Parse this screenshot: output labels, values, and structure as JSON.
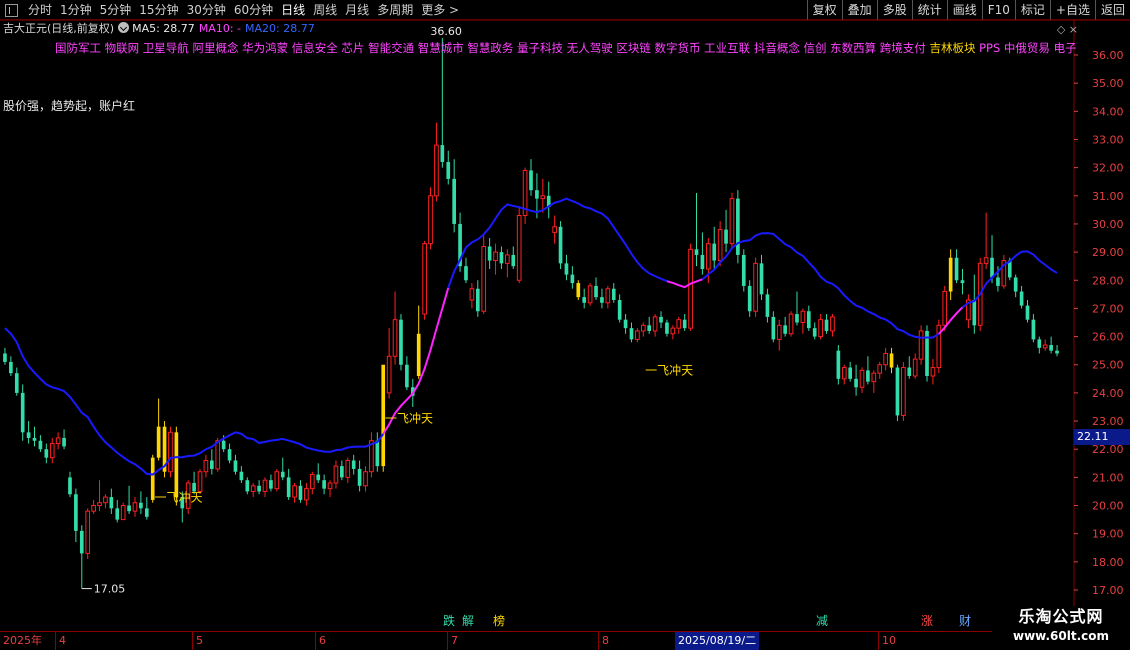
{
  "toolbar": {
    "tabs": [
      "分时",
      "1分钟",
      "5分钟",
      "15分钟",
      "30分钟",
      "60分钟",
      "日线",
      "周线",
      "月线",
      "多周期",
      "更多"
    ],
    "active_tab": "日线",
    "more_suffix": ">",
    "right_buttons": [
      "复权",
      "叠加",
      "多股",
      "统计",
      "画线",
      "F10",
      "+自选",
      "返回"
    ],
    "mark_label": "标记"
  },
  "info": {
    "stock_title": "吉大正元(日线,前复权)",
    "ma5": "MA5: 28.77",
    "ma10": "MA10: -",
    "ma20": "MA20: 28.77",
    "corner_icons": "◇ ×"
  },
  "concepts": "国防军工 物联网 卫星导航 阿里概念 华为鸿蒙 信息安全 芯片 智能交通 智慧城市 智慧政务 量子科技 无人驾驶 区块链 数字货币 工业互联 抖音概念 信创 东数西算 跨境支付 吉林板块 PPS 中俄贸易 电子身份",
  "concept_highlight": "吉林板块",
  "slogan": "股价强，趋势起，账户红",
  "colors": {
    "up": "#ff2020",
    "down": "#33ddaa",
    "signal": "#ffd700",
    "ma_blue": "#1a1aff",
    "ma_pink": "#ff22ff",
    "axis": "#e84040"
  },
  "chart_data": {
    "type": "candlestick",
    "y_axis": {
      "ticks": [
        "36.00",
        "35.00",
        "34.00",
        "33.00",
        "32.00",
        "31.00",
        "30.00",
        "29.00",
        "28.00",
        "27.00",
        "26.00",
        "25.00",
        "24.00",
        "23.00",
        "22.00",
        "21.00",
        "20.00",
        "19.00",
        "18.00",
        "17.00"
      ],
      "range": [
        17.0,
        36.5
      ],
      "current_marker": "22.11"
    },
    "annotations": {
      "high": "36.60",
      "low": "17.05",
      "signal_text": "一飞冲天"
    },
    "candles": [
      [
        25.4,
        25.6,
        25.0,
        25.1
      ],
      [
        25.1,
        25.3,
        24.6,
        24.7
      ],
      [
        24.7,
        24.9,
        23.9,
        24.0
      ],
      [
        24.0,
        24.3,
        22.3,
        22.6
      ],
      [
        22.6,
        23.0,
        22.2,
        22.4
      ],
      [
        22.4,
        22.8,
        22.1,
        22.3
      ],
      [
        22.3,
        22.5,
        21.9,
        22.0
      ],
      [
        22.0,
        22.2,
        21.5,
        21.7
      ],
      [
        21.7,
        22.4,
        21.5,
        22.2
      ],
      [
        22.2,
        22.6,
        22.0,
        22.4
      ],
      [
        22.4,
        22.7,
        22.0,
        22.1
      ],
      [
        21.0,
        21.2,
        20.3,
        20.4
      ],
      [
        20.4,
        20.6,
        18.7,
        19.1
      ],
      [
        19.1,
        19.3,
        17.05,
        18.3
      ],
      [
        18.3,
        19.9,
        18.1,
        19.8
      ],
      [
        19.8,
        20.2,
        19.7,
        20.0
      ],
      [
        20.0,
        20.9,
        19.8,
        20.1
      ],
      [
        20.1,
        20.4,
        19.9,
        20.3
      ],
      [
        20.3,
        20.6,
        19.7,
        19.9
      ],
      [
        19.9,
        20.2,
        19.4,
        19.5
      ],
      [
        19.5,
        20.1,
        19.5,
        20.0
      ],
      [
        20.0,
        20.7,
        19.7,
        19.8
      ],
      [
        19.8,
        20.3,
        19.6,
        20.1
      ],
      [
        20.1,
        20.5,
        19.7,
        19.9
      ],
      [
        19.9,
        20.3,
        19.5,
        19.6
      ],
      [
        20.2,
        21.8,
        20.1,
        21.7
      ],
      [
        21.7,
        23.8,
        21.6,
        22.8
      ],
      [
        22.8,
        23.0,
        21.0,
        21.2
      ],
      [
        21.2,
        22.8,
        21.0,
        22.6
      ],
      [
        22.6,
        22.8,
        20.0,
        20.3
      ],
      [
        20.3,
        20.5,
        19.4,
        19.9
      ],
      [
        19.9,
        20.9,
        19.7,
        20.8
      ],
      [
        20.8,
        21.2,
        20.4,
        20.5
      ],
      [
        20.5,
        21.3,
        20.4,
        21.2
      ],
      [
        21.2,
        21.8,
        21.0,
        21.6
      ],
      [
        21.6,
        22.0,
        21.1,
        21.3
      ],
      [
        21.3,
        22.4,
        21.2,
        22.3
      ],
      [
        22.3,
        22.5,
        21.9,
        22.0
      ],
      [
        22.0,
        22.2,
        21.5,
        21.6
      ],
      [
        21.6,
        21.8,
        21.1,
        21.2
      ],
      [
        21.2,
        21.4,
        20.8,
        20.9
      ],
      [
        20.9,
        21.0,
        20.4,
        20.5
      ],
      [
        20.5,
        20.8,
        20.3,
        20.7
      ],
      [
        20.7,
        20.9,
        20.4,
        20.5
      ],
      [
        20.5,
        21.0,
        20.3,
        20.9
      ],
      [
        20.9,
        21.1,
        20.5,
        20.6
      ],
      [
        20.6,
        21.3,
        20.5,
        21.2
      ],
      [
        21.2,
        21.7,
        20.9,
        21.0
      ],
      [
        21.0,
        21.3,
        20.2,
        20.3
      ],
      [
        20.3,
        20.8,
        20.1,
        20.7
      ],
      [
        20.7,
        20.9,
        20.1,
        20.2
      ],
      [
        20.2,
        20.8,
        20.0,
        20.6
      ],
      [
        20.6,
        21.2,
        20.4,
        21.1
      ],
      [
        21.1,
        21.5,
        20.8,
        20.9
      ],
      [
        20.9,
        21.1,
        20.4,
        20.6
      ],
      [
        20.6,
        20.9,
        20.3,
        20.8
      ],
      [
        20.8,
        21.6,
        20.6,
        21.4
      ],
      [
        21.4,
        21.6,
        20.9,
        21.0
      ],
      [
        21.0,
        21.7,
        20.8,
        21.6
      ],
      [
        21.6,
        21.8,
        21.1,
        21.3
      ],
      [
        21.3,
        21.6,
        20.5,
        20.7
      ],
      [
        20.7,
        21.4,
        20.5,
        21.2
      ],
      [
        21.2,
        22.6,
        21.0,
        22.3
      ],
      [
        22.3,
        22.6,
        21.2,
        21.4
      ],
      [
        21.4,
        24.3,
        21.2,
        25.0
      ],
      [
        24.0,
        26.3,
        23.8,
        25.3
      ],
      [
        25.3,
        27.6,
        25.0,
        26.6
      ],
      [
        26.6,
        26.8,
        24.8,
        25.0
      ],
      [
        25.0,
        25.3,
        24.1,
        24.2
      ],
      [
        24.2,
        24.5,
        23.5,
        23.9
      ],
      [
        24.6,
        27.1,
        24.5,
        26.1
      ],
      [
        26.8,
        29.4,
        26.6,
        29.3
      ],
      [
        29.3,
        31.3,
        29.1,
        31.0
      ],
      [
        31.0,
        33.6,
        30.8,
        32.8
      ],
      [
        32.8,
        36.6,
        32.0,
        32.2
      ],
      [
        32.2,
        32.6,
        31.4,
        31.6
      ],
      [
        31.6,
        32.3,
        29.7,
        30.0
      ],
      [
        30.0,
        30.4,
        28.3,
        28.5
      ],
      [
        28.5,
        28.8,
        27.9,
        28.0
      ],
      [
        27.3,
        27.9,
        27.0,
        27.7
      ],
      [
        27.7,
        28.0,
        26.7,
        26.9
      ],
      [
        26.9,
        29.6,
        26.8,
        29.2
      ],
      [
        29.2,
        29.5,
        28.4,
        28.7
      ],
      [
        28.7,
        29.3,
        28.2,
        29.0
      ],
      [
        29.0,
        29.2,
        28.4,
        28.6
      ],
      [
        28.6,
        29.1,
        28.1,
        28.9
      ],
      [
        28.9,
        29.2,
        28.4,
        28.5
      ],
      [
        28.0,
        30.6,
        27.9,
        30.3
      ],
      [
        30.3,
        32.0,
        30.0,
        31.9
      ],
      [
        31.9,
        32.3,
        31.0,
        31.2
      ],
      [
        31.2,
        31.8,
        30.2,
        30.9
      ],
      [
        30.9,
        31.6,
        30.4,
        31.0
      ],
      [
        31.0,
        31.5,
        30.2,
        30.6
      ],
      [
        29.7,
        30.3,
        29.3,
        29.9
      ],
      [
        29.9,
        30.1,
        28.4,
        28.6
      ],
      [
        28.6,
        28.9,
        28.0,
        28.2
      ],
      [
        28.2,
        28.5,
        27.7,
        27.9
      ],
      [
        27.9,
        28.0,
        27.3,
        27.4
      ],
      [
        27.4,
        27.7,
        27.0,
        27.2
      ],
      [
        27.2,
        27.9,
        27.1,
        27.8
      ],
      [
        27.8,
        28.1,
        27.3,
        27.4
      ],
      [
        27.4,
        27.7,
        27.0,
        27.2
      ],
      [
        27.2,
        27.8,
        27.0,
        27.7
      ],
      [
        27.7,
        27.9,
        27.2,
        27.3
      ],
      [
        27.3,
        27.5,
        26.5,
        26.6
      ],
      [
        26.6,
        26.8,
        26.1,
        26.3
      ],
      [
        26.3,
        26.5,
        25.8,
        25.9
      ],
      [
        25.9,
        26.3,
        25.8,
        26.2
      ],
      [
        26.2,
        26.5,
        26.0,
        26.4
      ],
      [
        26.4,
        26.7,
        26.1,
        26.2
      ],
      [
        26.2,
        26.8,
        26.0,
        26.7
      ],
      [
        26.7,
        26.9,
        26.3,
        26.5
      ],
      [
        26.5,
        26.6,
        26.0,
        26.1
      ],
      [
        26.1,
        26.4,
        25.9,
        26.3
      ],
      [
        26.3,
        26.7,
        26.1,
        26.6
      ],
      [
        26.6,
        26.8,
        26.2,
        26.3
      ],
      [
        26.3,
        29.3,
        26.2,
        29.1
      ],
      [
        29.1,
        31.1,
        28.5,
        28.9
      ],
      [
        28.9,
        29.7,
        28.2,
        28.4
      ],
      [
        28.4,
        29.5,
        27.9,
        29.3
      ],
      [
        29.3,
        29.9,
        28.4,
        28.7
      ],
      [
        28.7,
        30.1,
        28.5,
        29.8
      ],
      [
        29.8,
        30.5,
        29.0,
        29.3
      ],
      [
        29.3,
        31.1,
        29.1,
        30.9
      ],
      [
        30.9,
        31.2,
        28.6,
        28.9
      ],
      [
        28.9,
        29.1,
        27.6,
        27.8
      ],
      [
        27.8,
        28.0,
        26.7,
        26.9
      ],
      [
        26.9,
        28.8,
        26.7,
        28.6
      ],
      [
        28.6,
        28.9,
        27.3,
        27.5
      ],
      [
        27.5,
        27.7,
        26.5,
        26.7
      ],
      [
        26.7,
        26.9,
        25.8,
        25.9
      ],
      [
        25.9,
        26.6,
        25.5,
        26.4
      ],
      [
        26.4,
        26.7,
        26.0,
        26.1
      ],
      [
        26.1,
        26.9,
        26.0,
        26.8
      ],
      [
        26.8,
        27.6,
        26.4,
        26.5
      ],
      [
        26.5,
        27.0,
        26.1,
        26.9
      ],
      [
        26.9,
        27.1,
        26.2,
        26.3
      ],
      [
        26.3,
        26.5,
        25.9,
        26.0
      ],
      [
        26.0,
        26.8,
        25.9,
        26.6
      ],
      [
        26.6,
        26.8,
        26.1,
        26.2
      ],
      [
        26.2,
        26.8,
        26.0,
        26.7
      ],
      [
        25.5,
        25.7,
        24.3,
        24.5
      ],
      [
        24.5,
        25.0,
        24.3,
        24.9
      ],
      [
        24.9,
        25.1,
        24.4,
        24.5
      ],
      [
        24.5,
        25.0,
        23.9,
        24.2
      ],
      [
        24.2,
        24.9,
        24.0,
        24.8
      ],
      [
        24.8,
        25.3,
        24.3,
        24.4
      ],
      [
        24.4,
        24.8,
        24.0,
        24.7
      ],
      [
        24.7,
        25.1,
        24.5,
        25.0
      ],
      [
        25.0,
        25.6,
        24.8,
        25.4
      ],
      [
        25.4,
        25.6,
        24.7,
        24.9
      ],
      [
        24.9,
        25.0,
        23.0,
        23.2
      ],
      [
        23.2,
        25.1,
        23.0,
        24.9
      ],
      [
        24.9,
        25.3,
        24.5,
        24.6
      ],
      [
        24.6,
        25.4,
        24.5,
        25.2
      ],
      [
        25.2,
        26.4,
        25.0,
        26.2
      ],
      [
        26.2,
        26.4,
        24.4,
        24.6
      ],
      [
        24.6,
        25.2,
        24.3,
        24.9
      ],
      [
        24.9,
        26.6,
        24.7,
        26.4
      ],
      [
        26.4,
        27.8,
        26.2,
        27.6
      ],
      [
        27.6,
        29.1,
        27.3,
        28.8
      ],
      [
        28.8,
        29.1,
        27.9,
        28.0
      ],
      [
        28.0,
        28.4,
        27.5,
        27.9
      ],
      [
        26.6,
        27.5,
        26.3,
        27.3
      ],
      [
        27.3,
        28.2,
        26.1,
        26.4
      ],
      [
        26.4,
        28.8,
        26.2,
        28.6
      ],
      [
        28.6,
        30.4,
        28.4,
        28.8
      ],
      [
        28.8,
        29.6,
        27.9,
        28.1
      ],
      [
        28.1,
        28.5,
        27.6,
        27.8
      ],
      [
        27.8,
        28.9,
        27.7,
        28.7
      ],
      [
        28.7,
        28.8,
        28.0,
        28.1
      ],
      [
        28.1,
        28.2,
        27.4,
        27.6
      ],
      [
        27.6,
        27.8,
        27.0,
        27.1
      ],
      [
        27.1,
        27.3,
        26.5,
        26.6
      ],
      [
        26.6,
        26.8,
        25.8,
        25.9
      ],
      [
        25.9,
        26.0,
        25.4,
        25.6
      ],
      [
        25.6,
        25.9,
        25.5,
        25.7
      ],
      [
        25.7,
        26.0,
        25.4,
        25.5
      ],
      [
        25.5,
        25.7,
        25.3,
        25.4
      ]
    ],
    "signal_candle_indices": [
      25,
      26,
      27,
      29,
      64,
      70,
      97,
      150,
      160
    ]
  },
  "signals": {
    "s1": "跌",
    "s2": "解",
    "s3": "榜",
    "s4": "减",
    "s5": "涨",
    "s6": "财"
  },
  "timeline": {
    "year": "2025年",
    "months": [
      "4",
      "5",
      "6",
      "7",
      "8",
      "10"
    ],
    "selected_date": "2025/08/19/二"
  },
  "watermark": {
    "name": "乐淘公式网",
    "url": "www.60lt.com"
  }
}
